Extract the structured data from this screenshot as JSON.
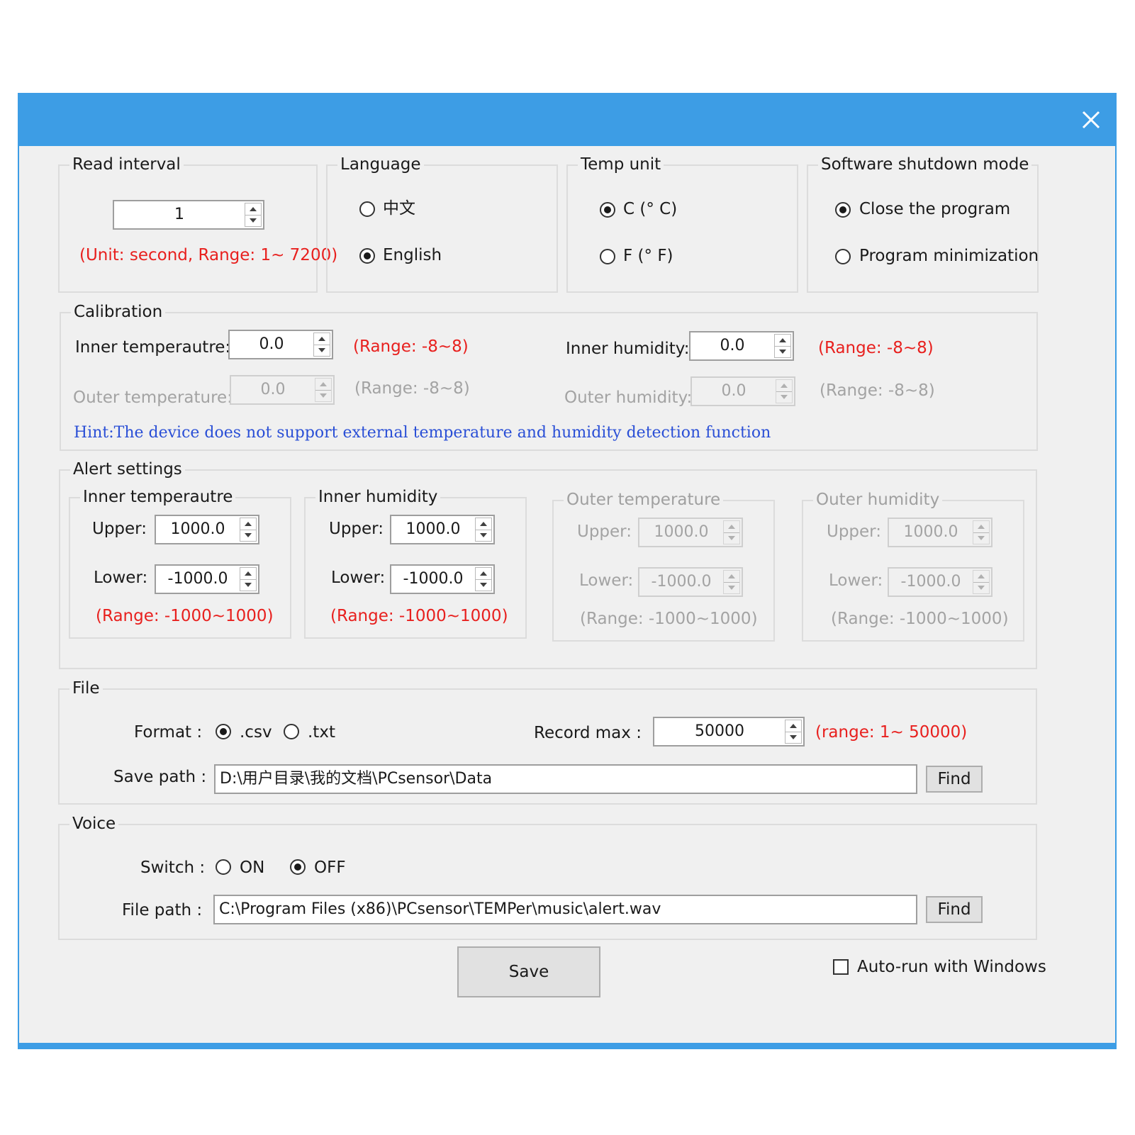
{
  "read_interval": {
    "title": "Read interval",
    "value": "1",
    "hint": "(Unit: second, Range: 1~ 7200)"
  },
  "language": {
    "title": "Language",
    "options": [
      "中文",
      "English"
    ],
    "selected": "English"
  },
  "temp_unit": {
    "title": "Temp unit",
    "options": [
      "C (° C)",
      "F (° F)"
    ],
    "selected": "C (° C)"
  },
  "shutdown": {
    "title": "Software shutdown mode",
    "options": [
      "Close the program",
      "Program minimization"
    ],
    "selected": "Close the program"
  },
  "calibration": {
    "title": "Calibration",
    "inner_temp_label": "Inner temperautre:",
    "inner_temp_value": "0.0",
    "inner_temp_range": "(Range: -8~8)",
    "inner_hum_label": "Inner humidity:",
    "inner_hum_value": "0.0",
    "inner_hum_range": "(Range: -8~8)",
    "outer_temp_label": "Outer temperature:",
    "outer_temp_value": "0.0",
    "outer_temp_range": "(Range: -8~8)",
    "outer_hum_label": "Outer humidity:",
    "outer_hum_value": "0.0",
    "outer_hum_range": "(Range: -8~8)",
    "hint": "Hint:The device does not support external temperature and humidity detection function"
  },
  "alert": {
    "title": "Alert settings",
    "upper_label": "Upper:",
    "lower_label": "Lower:",
    "groups": [
      {
        "title": "Inner temperautre",
        "upper": "1000.0",
        "lower": "-1000.0",
        "range": "(Range: -1000~1000)",
        "enabled": true
      },
      {
        "title": "Inner humidity",
        "upper": "1000.0",
        "lower": "-1000.0",
        "range": "(Range: -1000~1000)",
        "enabled": true
      },
      {
        "title": "Outer temperature",
        "upper": "1000.0",
        "lower": "-1000.0",
        "range": "(Range: -1000~1000)",
        "enabled": false
      },
      {
        "title": "Outer humidity",
        "upper": "1000.0",
        "lower": "-1000.0",
        "range": "(Range: -1000~1000)",
        "enabled": false
      }
    ]
  },
  "file": {
    "title": "File",
    "format_label": "Format :",
    "format_options": [
      ".csv",
      ".txt"
    ],
    "format_selected": ".csv",
    "record_max_label": "Record max :",
    "record_max_value": "50000",
    "record_max_range": "(range: 1~ 50000)",
    "save_path_label": "Save path :",
    "save_path_value": "D:\\用户目录\\我的文档\\PCsensor\\Data",
    "find_label": "Find"
  },
  "voice": {
    "title": "Voice",
    "switch_label": "Switch :",
    "switch_options": [
      "ON",
      "OFF"
    ],
    "switch_selected": "OFF",
    "file_path_label": "File path :",
    "file_path_value": "C:\\Program Files (x86)\\PCsensor\\TEMPer\\music\\alert.wav",
    "find_label": "Find"
  },
  "save_label": "Save",
  "autorun_label": "Auto-run with Windows",
  "autorun_checked": false,
  "colors": {
    "titlebar": "#3d9de5",
    "range_hint": "#e8201e",
    "device_hint": "#2a4fd6",
    "disabled_text": "#a3a3a3"
  }
}
